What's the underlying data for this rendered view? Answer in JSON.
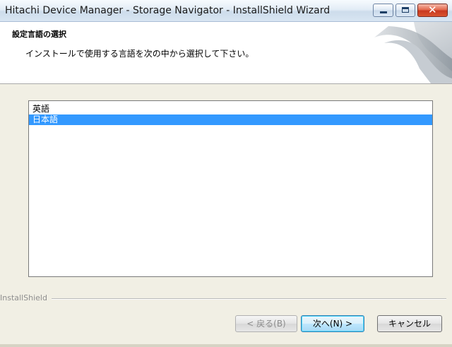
{
  "window": {
    "title": "Hitachi Device Manager - Storage Navigator - InstallShield Wizard"
  },
  "header": {
    "title": "設定言語の選択",
    "description": "インストールで使用する言語を次の中から選択して下さい。"
  },
  "language_list": {
    "items": [
      {
        "label": "英語",
        "selected": false
      },
      {
        "label": "日本語",
        "selected": true
      }
    ]
  },
  "footer": {
    "brand": "InstallShield"
  },
  "buttons": {
    "back": "< 戻る(B)",
    "next": "次へ(N) >",
    "cancel": "キャンセル"
  },
  "colors": {
    "selection": "#3399ff",
    "titlebar": "#dce8f4"
  }
}
